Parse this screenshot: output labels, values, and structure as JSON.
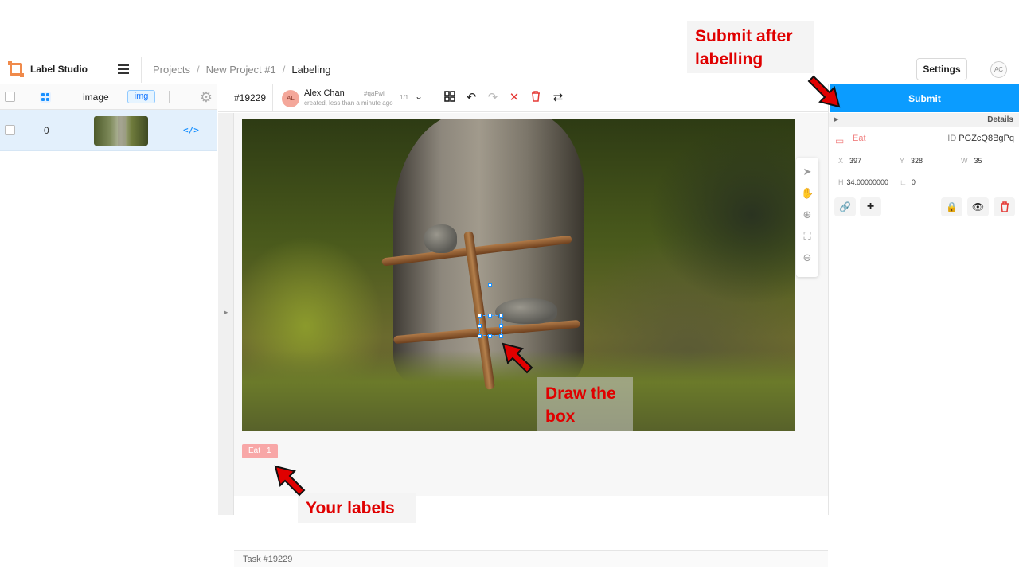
{
  "header": {
    "brand": "Label Studio",
    "breadcrumb": [
      "Projects",
      "New Project #1",
      "Labeling"
    ],
    "separator": "/",
    "settings_label": "Settings",
    "user_initials": "AC"
  },
  "task_list": {
    "columns": {
      "image": "image",
      "type_tag": "img"
    },
    "rows": [
      {
        "id": "0",
        "code_icon": "</>"
      }
    ]
  },
  "toolbar": {
    "task_number": "#19229",
    "annotator": {
      "initials": "AL",
      "name": "Alex Chan",
      "hash": "#qaFwi",
      "created": "created, less than a minute ago",
      "count": "1/1"
    },
    "icons": [
      "grid-icon",
      "undo-icon",
      "redo-icon",
      "reset-icon",
      "delete-icon",
      "swap-icon"
    ]
  },
  "canvas": {
    "tools": [
      "pointer-icon",
      "hand-icon",
      "zoom-in-icon",
      "fit-icon",
      "zoom-out-icon"
    ]
  },
  "labels": [
    {
      "name": "Eat",
      "count": "1",
      "color": "#f8a7a7"
    }
  ],
  "footer": {
    "task_label": "Task #19229"
  },
  "right_panel": {
    "submit_label": "Submit",
    "details_label": "Details",
    "region": {
      "label": "Eat",
      "id_key": "ID",
      "id_value": "PGZcQ8BgPq",
      "x_key": "X",
      "x": "397",
      "y_key": "Y",
      "y": "328",
      "w_key": "W",
      "w": "35",
      "h_key": "H",
      "h": "34.00000000",
      "angle_key": "∟",
      "angle": "0"
    }
  },
  "callouts": {
    "submit": "Submit after labelling",
    "draw": "Draw the box",
    "labels": "Your labels"
  },
  "colors": {
    "accent": "#0b9cff",
    "annotation_red": "#e00000",
    "label_pink": "#f8a7a7"
  }
}
